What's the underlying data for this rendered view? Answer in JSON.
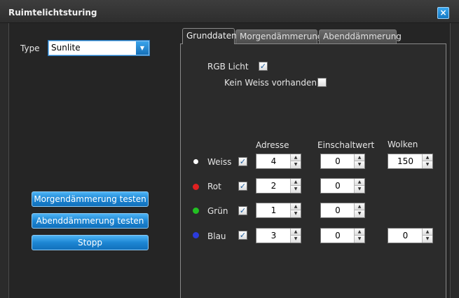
{
  "window": {
    "title": "Ruimtelichtsturing",
    "close_glyph": "×"
  },
  "type_field": {
    "label": "Type",
    "value": "Sunlite",
    "arrow": "▼"
  },
  "buttons": {
    "test_morning": "Morgendämmerung testen",
    "test_evening": "Abenddämmerung testen",
    "stop": "Stopp"
  },
  "tabs": [
    {
      "label": "Grunddaten",
      "active": true
    },
    {
      "label": "Morgendämmerung",
      "active": false
    },
    {
      "label": "Abenddämmerung",
      "active": false
    }
  ],
  "grunddaten": {
    "rgb_light": {
      "label": "RGB Licht",
      "checked": true
    },
    "no_white": {
      "label": "Kein Weiss vorhanden",
      "checked": false
    },
    "columns": {
      "address": "Adresse",
      "switch_on": "Einschaltwert",
      "clouds": "Wolken"
    },
    "channels": [
      {
        "name": "Weiss",
        "color": "#ffffff",
        "enabled": true,
        "address": "4",
        "switch_on": "0",
        "clouds": "150"
      },
      {
        "name": "Rot",
        "color": "#e02020",
        "enabled": true,
        "address": "2",
        "switch_on": "0"
      },
      {
        "name": "Grün",
        "color": "#22c022",
        "enabled": true,
        "address": "1",
        "switch_on": "0"
      },
      {
        "name": "Blau",
        "color": "#2b3bdc",
        "enabled": true,
        "address": "3",
        "switch_on": "0",
        "clouds": "0"
      }
    ]
  },
  "glyphs": {
    "check": "✓",
    "up": "▲",
    "down": "▼"
  }
}
